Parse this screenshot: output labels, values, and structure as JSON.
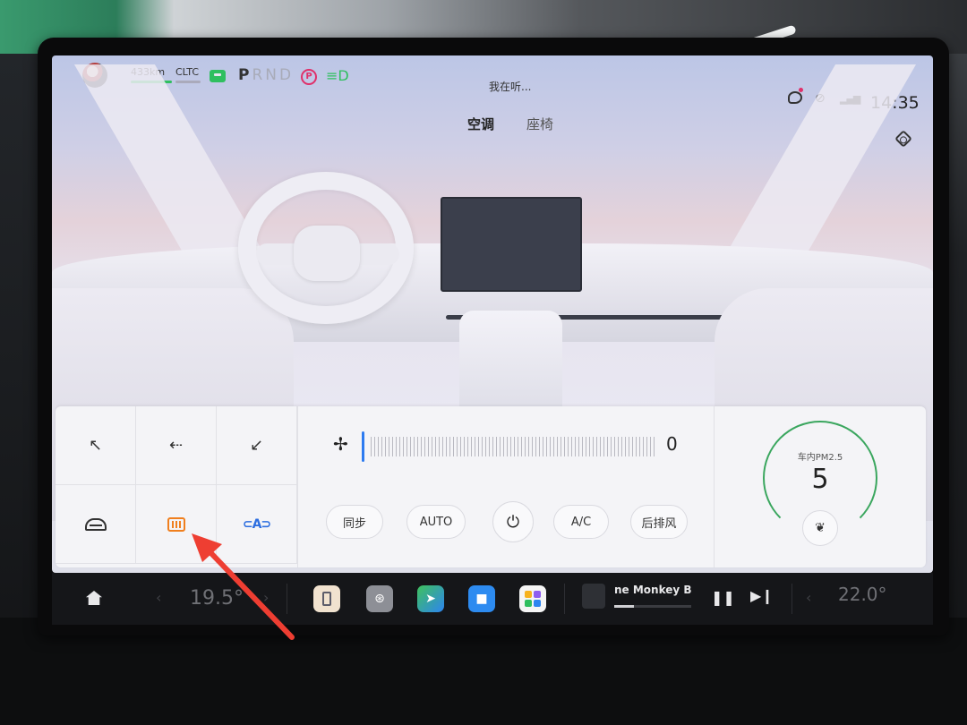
{
  "status_bar": {
    "range": "433km",
    "range_mode": "CLTC",
    "gears": [
      "P",
      "R",
      "N",
      "D"
    ],
    "park_label": "P",
    "voice_status": "我在听...",
    "time": "14:35"
  },
  "tabs": [
    {
      "label": "空调",
      "active": true
    },
    {
      "label": "座椅",
      "active": false
    }
  ],
  "climate": {
    "fan_speed": "0",
    "buttons": {
      "sync": "同步",
      "auto": "AUTO",
      "power": "⏻",
      "ac": "A/C",
      "rear": "后排风"
    },
    "recirc_label": "⊂A⊃",
    "pm_label": "车内PM2.5",
    "pm_value": "5",
    "active_color": "#f07f1e",
    "accent_color": "#2d7bf0"
  },
  "dock": {
    "temp_left": "19.5°",
    "temp_right": "22.0°",
    "media_title": "ne Monkey Bee",
    "media_progress": 0.25,
    "apps": [
      "phone-icon",
      "steering-wheel-icon",
      "maps-icon",
      "video-call-icon",
      "app-grid-icon"
    ]
  }
}
